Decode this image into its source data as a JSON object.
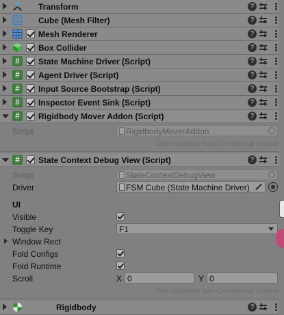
{
  "components": {
    "transform": "Transform",
    "mesh_filter": "Cube (Mesh Filter)",
    "mesh_renderer": "Mesh Renderer",
    "box_collider": "Box Collider",
    "state_machine_driver": "State Machine Driver (Script)",
    "agent_driver": "Agent Driver (Script)",
    "input_source_bootstrap": "Input Source Bootstrap (Script)",
    "inspector_event_sink": "Inspector Event Sink (Script)",
    "rigidbody_mover_addon": "Rigidbody Mover Addon (Script)",
    "state_context_debug_view": "State Context Debug View (Script)",
    "rigidbody": "Rigidbody"
  },
  "hash_icon_glyph": "#",
  "help_glyph": "?",
  "rigidbody_mover": {
    "script_label": "Script",
    "script_value": "RigidbodyMoverAddon",
    "watermark": "Odin Inspector Non-Commercial Version"
  },
  "debug_view": {
    "script_label": "Script",
    "script_value": "StateContextDebugView",
    "driver_label": "Driver",
    "driver_value": "FSM Cube (State Machine Driver)",
    "ui_header": "UI",
    "visible_label": "Visible",
    "toggle_key_label": "Toggle Key",
    "toggle_key_value": "F1",
    "window_rect_label": "Window Rect",
    "fold_configs_label": "Fold Configs",
    "fold_runtime_label": "Fold Runtime",
    "scroll_label": "Scroll",
    "scroll_x_label": "X",
    "scroll_x_value": "0",
    "scroll_y_label": "Y",
    "scroll_y_value": "0",
    "watermark": "Odin Inspector Non-Commercial Version"
  },
  "colors": {
    "script_icon": "#3f7a3f",
    "background": "#808080"
  }
}
